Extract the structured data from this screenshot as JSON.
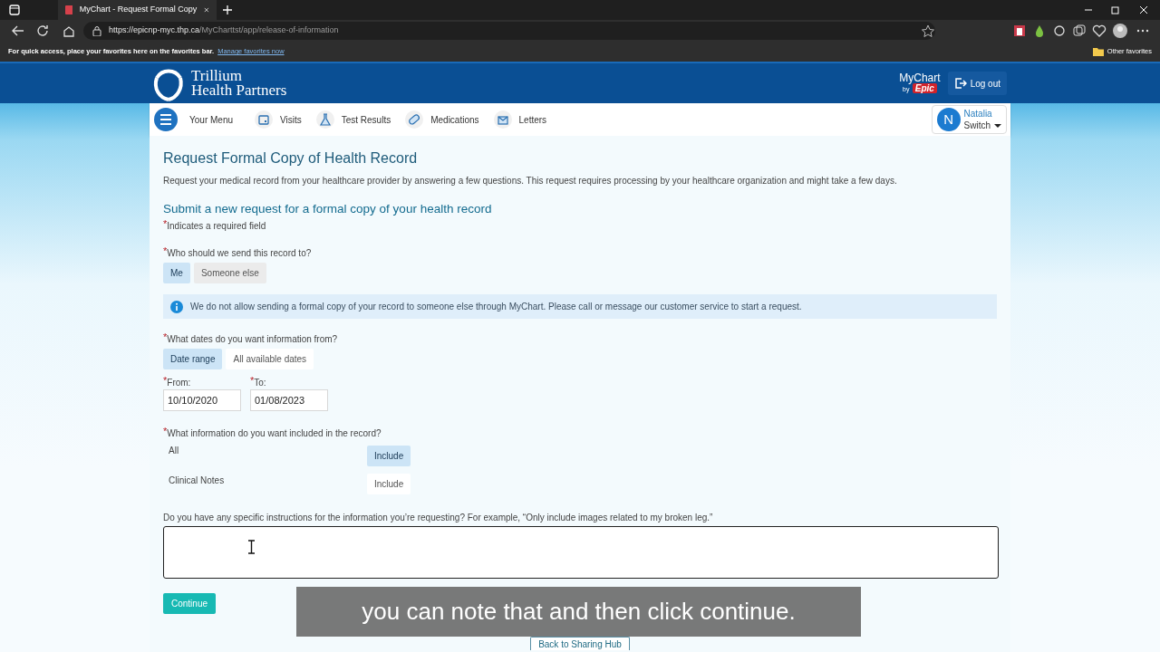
{
  "browser": {
    "tab_title": "MyChart - Request Formal Copy",
    "url_host": "https://epicnp-myc.thp.ca",
    "url_path": "/MyCharttst/app/release-of-information",
    "favorites_text": "For quick access, place your favorites here on the favorites bar.",
    "favorites_link": "Manage favorites now",
    "other_favorites": "Other favorites"
  },
  "header": {
    "org_name": [
      "Trillium",
      "Health Partners"
    ],
    "mychart_brand": "MyChart",
    "mychart_by": "by",
    "mychart_vendor": "Epic",
    "logout": "Log out"
  },
  "nav": {
    "menu": "Your Menu",
    "items": [
      {
        "label": "Visits",
        "kind": "calendar"
      },
      {
        "label": "Test Results",
        "kind": "flask"
      },
      {
        "label": "Medications",
        "kind": "pill"
      },
      {
        "label": "Letters",
        "kind": "letter"
      }
    ],
    "user": {
      "initial": "N",
      "name": "Natalia",
      "switch": "Switch"
    }
  },
  "page": {
    "title": "Request Formal Copy of Health Record",
    "description": "Request your medical record from your healthcare provider by answering a few questions. This request requires processing by your healthcare organization and might take a few days.",
    "subtitle": "Submit a new request for a formal copy of your health record",
    "required_mark": "*",
    "required_note": "Indicates a required field",
    "recipient": {
      "mark": "*",
      "label": "Who should we send this record to?",
      "options": [
        {
          "label": "Me",
          "selected": true
        },
        {
          "label": "Someone else",
          "selected": false
        }
      ]
    },
    "notice": "We do not allow sending a formal copy of your record to someone else through MyChart. Please call or message our customer service to start a request.",
    "dates": {
      "mark": "*",
      "label": "What dates do you want information from?",
      "options": [
        {
          "label": "Date range",
          "selected": true
        },
        {
          "label": "All available dates",
          "selected": false
        }
      ],
      "from": {
        "mark": "*",
        "label": "From:",
        "value": "10/10/2020"
      },
      "to": {
        "mark": "*",
        "label": "To:",
        "value": "01/08/2023"
      }
    },
    "information": {
      "mark": "*",
      "label": "What information do you want included in the record?",
      "rows": [
        {
          "label": "All",
          "button": "Include",
          "selected": true
        },
        {
          "label": "Clinical Notes",
          "button": "Include",
          "selected": false
        }
      ]
    },
    "instructions": {
      "label": "Do you have any specific instructions for the information you’re requesting? For example, “Only include images related to my broken leg.”"
    },
    "continue": "Continue",
    "back": "Back to Sharing Hub"
  },
  "caption": "you can note that and then click continue."
}
